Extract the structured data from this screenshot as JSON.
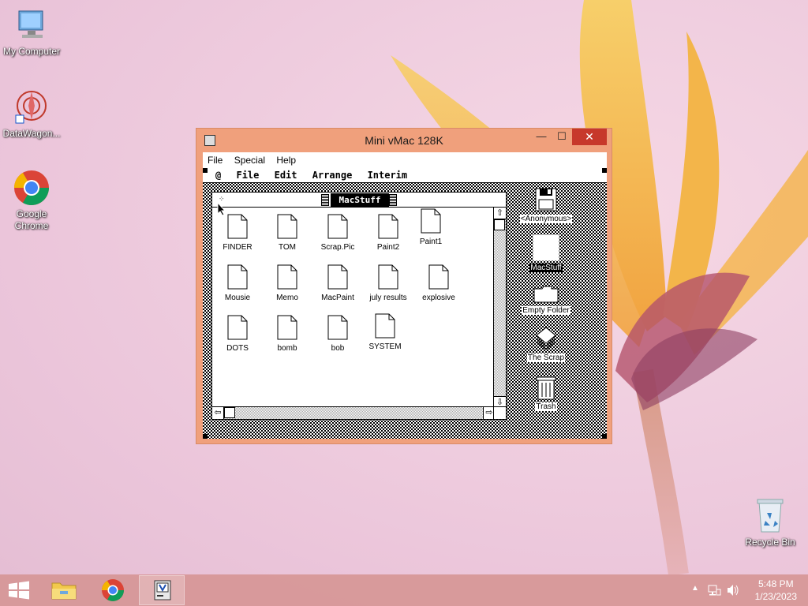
{
  "desktop": {
    "icons": [
      {
        "label": "My Computer"
      },
      {
        "label": "DataWagon..."
      },
      {
        "label": "Google Chrome"
      },
      {
        "label": "Recycle Bin"
      }
    ]
  },
  "window": {
    "title": "Mini vMac 128K",
    "menu": [
      "File",
      "Special",
      "Help"
    ],
    "min": "—",
    "max": "☐",
    "close": "✕"
  },
  "mac": {
    "menubar": [
      "@",
      "File",
      "Edit",
      "Arrange",
      "Interim"
    ],
    "finder": {
      "title": "MacStuff",
      "files": [
        {
          "name": "FINDER"
        },
        {
          "name": "TOM"
        },
        {
          "name": "Scrap.Pic"
        },
        {
          "name": "Paint2"
        },
        {
          "name": "Paint1"
        },
        {
          "name": "Mousie"
        },
        {
          "name": "Memo"
        },
        {
          "name": "MacPaint"
        },
        {
          "name": "july results"
        },
        {
          "name": "explosive"
        },
        {
          "name": "DOTS"
        },
        {
          "name": "bomb"
        },
        {
          "name": "bob"
        },
        {
          "name": "SYSTEM"
        }
      ]
    },
    "desktop_icons": [
      {
        "label": "<Anonymous>"
      },
      {
        "label": "MacStuff"
      },
      {
        "label": "Empty Folder"
      },
      {
        "label": "The Scrap"
      },
      {
        "label": "Trash"
      }
    ]
  },
  "taskbar": {
    "time": "5:48 PM",
    "date": "1/23/2023"
  },
  "colors": {
    "accent": "#f0a07c",
    "close": "#c7382b",
    "taskbar": "#d69696"
  }
}
